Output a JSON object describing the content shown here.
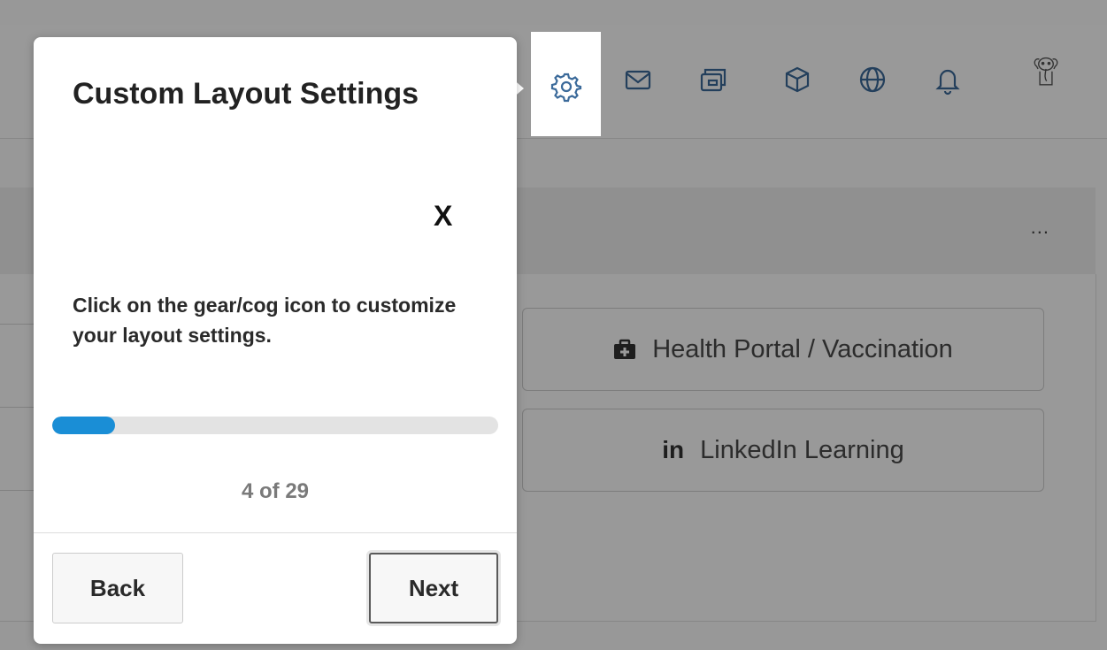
{
  "toolbar": {
    "icons": [
      "gear-icon",
      "mail-icon",
      "wallet-icon",
      "box-icon",
      "globe-icon",
      "bell-icon",
      "avatar-elephant"
    ]
  },
  "card": {
    "more_label": "...",
    "links": [
      {
        "label": "Health Portal / Vaccination",
        "icon": "medical-kit-icon"
      },
      {
        "label": "LinkedIn Learning",
        "icon": "linkedin-icon",
        "icon_text": "in"
      }
    ]
  },
  "tour": {
    "title": "Custom Layout Settings",
    "close_label": "X",
    "body": "Click on the gear/cog icon to customize your layout settings.",
    "progress": 0.14,
    "counter": "4 of 29",
    "back_label": "Back",
    "next_label": "Next"
  },
  "colors": {
    "accent": "#1a8ed6",
    "icon_blue": "#3b6a9a",
    "overlay": "rgba(0,0,0,0.40)"
  }
}
